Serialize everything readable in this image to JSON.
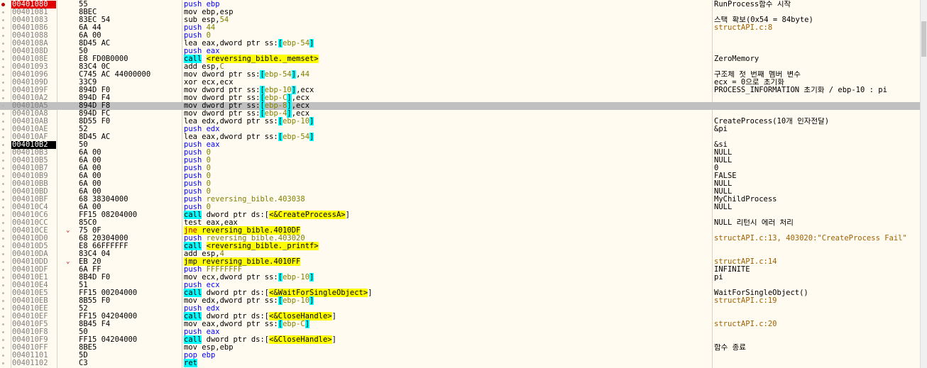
{
  "rows": [
    {
      "addr": "00401080",
      "bytes": "55",
      "asm": [
        {
          "t": "push ",
          "c": "k-push"
        },
        {
          "t": "ebp",
          "c": "k-push"
        }
      ],
      "comment": "RunProcess함수 시작",
      "bp": true,
      "addr_style": "red"
    },
    {
      "addr": "00401081",
      "bytes": "8BEC",
      "asm": [
        {
          "t": "mov ebp,esp"
        }
      ],
      "comment": ""
    },
    {
      "addr": "00401083",
      "bytes": "83EC 54",
      "asm": [
        {
          "t": "sub esp,"
        },
        {
          "t": "54",
          "c": "k-num"
        }
      ],
      "comment": "스택 확보(0x54 = 84byte)"
    },
    {
      "addr": "00401086",
      "bytes": "6A 44",
      "asm": [
        {
          "t": "push ",
          "c": "k-push"
        },
        {
          "t": "44",
          "c": "k-num"
        }
      ],
      "comment": "structAPI.c:8",
      "comment_style": "src"
    },
    {
      "addr": "00401088",
      "bytes": "6A 00",
      "asm": [
        {
          "t": "push ",
          "c": "k-push"
        },
        {
          "t": "0",
          "c": "k-num"
        }
      ],
      "comment": ""
    },
    {
      "addr": "0040108A",
      "bytes": "8D45 AC",
      "asm": [
        {
          "t": "lea eax,dword ptr ss:"
        },
        {
          "t": "[",
          "c": "hl-cy"
        },
        {
          "t": "ebp-54",
          "c": "k-num"
        },
        {
          "t": "]",
          "c": "hl-cy"
        }
      ],
      "comment": ""
    },
    {
      "addr": "0040108D",
      "bytes": "50",
      "asm": [
        {
          "t": "push ",
          "c": "k-push"
        },
        {
          "t": "eax",
          "c": "k-push"
        }
      ],
      "comment": ""
    },
    {
      "addr": "0040108E",
      "bytes": "E8 FD0B0000",
      "asm": [
        {
          "t": "call",
          "c": "hl-cy"
        },
        {
          "t": " "
        },
        {
          "t": "<reversing_bible._memset>",
          "c": "hl-ye"
        }
      ],
      "comment": "ZeroMemory"
    },
    {
      "addr": "00401093",
      "bytes": "83C4 0C",
      "asm": [
        {
          "t": "add esp,"
        },
        {
          "t": "C",
          "c": "k-num"
        }
      ],
      "comment": ""
    },
    {
      "addr": "00401096",
      "bytes": "C745 AC 44000000",
      "asm": [
        {
          "t": "mov dword ptr ss:"
        },
        {
          "t": "[",
          "c": "hl-cy"
        },
        {
          "t": "ebp-54",
          "c": "k-num"
        },
        {
          "t": "]",
          "c": "hl-cy"
        },
        {
          "t": ","
        },
        {
          "t": "44",
          "c": "k-num"
        }
      ],
      "comment": "구조체 첫 번째 멤버 변수"
    },
    {
      "addr": "0040109D",
      "bytes": "33C9",
      "asm": [
        {
          "t": "xor ecx,ecx"
        }
      ],
      "comment": "ecx = 0으로 초기화"
    },
    {
      "addr": "0040109F",
      "bytes": "894D F0",
      "asm": [
        {
          "t": "mov dword ptr ss:"
        },
        {
          "t": "[",
          "c": "hl-cy"
        },
        {
          "t": "ebp-10",
          "c": "k-num"
        },
        {
          "t": "]",
          "c": "hl-cy"
        },
        {
          "t": ",ecx"
        }
      ],
      "comment": "PROCESS_INFORMATION 초기화 / ebp-10 : pi"
    },
    {
      "addr": "004010A2",
      "bytes": "894D F4",
      "asm": [
        {
          "t": "mov dword ptr ss:"
        },
        {
          "t": "[",
          "c": "hl-cy"
        },
        {
          "t": "ebp-C",
          "c": "k-num"
        },
        {
          "t": "]",
          "c": "hl-cy"
        },
        {
          "t": ",ecx"
        }
      ],
      "comment": ""
    },
    {
      "addr": "004010A5",
      "bytes": "894D F8",
      "asm": [
        {
          "t": "mov dword ptr ss:"
        },
        {
          "t": "[",
          "c": "hl-cy"
        },
        {
          "t": "ebp-8",
          "c": "k-num"
        },
        {
          "t": "]",
          "c": "hl-cy"
        },
        {
          "t": ",ecx"
        }
      ],
      "comment": "",
      "selected": true
    },
    {
      "addr": "004010A8",
      "bytes": "894D FC",
      "asm": [
        {
          "t": "mov dword ptr ss:"
        },
        {
          "t": "[",
          "c": "hl-cy"
        },
        {
          "t": "ebp-4",
          "c": "k-num"
        },
        {
          "t": "]",
          "c": "hl-cy"
        },
        {
          "t": ",ecx"
        }
      ],
      "comment": ""
    },
    {
      "addr": "004010AB",
      "bytes": "8D55 F0",
      "asm": [
        {
          "t": "lea edx,dword ptr ss:"
        },
        {
          "t": "[",
          "c": "hl-cy"
        },
        {
          "t": "ebp-10",
          "c": "k-num"
        },
        {
          "t": "]",
          "c": "hl-cy"
        }
      ],
      "comment": "CreateProcess(10개 인자전달)"
    },
    {
      "addr": "004010AE",
      "bytes": "52",
      "asm": [
        {
          "t": "push ",
          "c": "k-push"
        },
        {
          "t": "edx",
          "c": "k-push"
        }
      ],
      "comment": "&pi"
    },
    {
      "addr": "004010AF",
      "bytes": "8D45 AC",
      "asm": [
        {
          "t": "lea eax,dword ptr ss:"
        },
        {
          "t": "[",
          "c": "hl-cy"
        },
        {
          "t": "ebp-54",
          "c": "k-num"
        },
        {
          "t": "]",
          "c": "hl-cy"
        }
      ],
      "comment": ""
    },
    {
      "addr": "004010B2",
      "bytes": "50",
      "asm": [
        {
          "t": "push ",
          "c": "k-push"
        },
        {
          "t": "eax",
          "c": "k-push"
        }
      ],
      "comment": "&si",
      "addr_style": "blk"
    },
    {
      "addr": "004010B3",
      "bytes": "6A 00",
      "asm": [
        {
          "t": "push ",
          "c": "k-push"
        },
        {
          "t": "0",
          "c": "k-num"
        }
      ],
      "comment": "NULL"
    },
    {
      "addr": "004010B5",
      "bytes": "6A 00",
      "asm": [
        {
          "t": "push ",
          "c": "k-push"
        },
        {
          "t": "0",
          "c": "k-num"
        }
      ],
      "comment": "NULL"
    },
    {
      "addr": "004010B7",
      "bytes": "6A 00",
      "asm": [
        {
          "t": "push ",
          "c": "k-push"
        },
        {
          "t": "0",
          "c": "k-num"
        }
      ],
      "comment": "0"
    },
    {
      "addr": "004010B9",
      "bytes": "6A 00",
      "asm": [
        {
          "t": "push ",
          "c": "k-push"
        },
        {
          "t": "0",
          "c": "k-num"
        }
      ],
      "comment": "FALSE"
    },
    {
      "addr": "004010BB",
      "bytes": "6A 00",
      "asm": [
        {
          "t": "push ",
          "c": "k-push"
        },
        {
          "t": "0",
          "c": "k-num"
        }
      ],
      "comment": "NULL"
    },
    {
      "addr": "004010BD",
      "bytes": "6A 00",
      "asm": [
        {
          "t": "push ",
          "c": "k-push"
        },
        {
          "t": "0",
          "c": "k-num"
        }
      ],
      "comment": "NULL"
    },
    {
      "addr": "004010BF",
      "bytes": "68 38304000",
      "asm": [
        {
          "t": "push ",
          "c": "k-push"
        },
        {
          "t": "reversing_bible.403038",
          "c": "k-lab"
        }
      ],
      "comment": "MyChildProcess"
    },
    {
      "addr": "004010C4",
      "bytes": "6A 00",
      "asm": [
        {
          "t": "push ",
          "c": "k-push"
        },
        {
          "t": "0",
          "c": "k-num"
        }
      ],
      "comment": "NULL"
    },
    {
      "addr": "004010C6",
      "bytes": "FF15 08204000",
      "asm": [
        {
          "t": "call",
          "c": "hl-cy"
        },
        {
          "t": " dword ptr ds:["
        },
        {
          "t": "<&CreateProcessA>",
          "c": "hl-ye"
        },
        {
          "t": "]"
        }
      ],
      "comment": ""
    },
    {
      "addr": "004010CC",
      "bytes": "85C0",
      "asm": [
        {
          "t": "test eax,eax"
        }
      ],
      "comment": "NULL 리턴시 에러 처리"
    },
    {
      "addr": "004010CE",
      "bytes": "75 0F",
      "asm": [
        {
          "t": "jne ",
          "c": "k-jcc hl-ye"
        },
        {
          "t": "reversing_bible.4010DF",
          "c": "hl-ye"
        }
      ],
      "comment": "",
      "jump": "⌄"
    },
    {
      "addr": "004010D0",
      "bytes": "68 20304000",
      "asm": [
        {
          "t": "push ",
          "c": "k-push"
        },
        {
          "t": "reversing_bible.403020",
          "c": "k-lab"
        }
      ],
      "comment": "structAPI.c:13, 403020:\"CreateProcess Fail\"",
      "comment_style": "src"
    },
    {
      "addr": "004010D5",
      "bytes": "E8 66FFFFFF",
      "asm": [
        {
          "t": "call",
          "c": "hl-cy"
        },
        {
          "t": " "
        },
        {
          "t": "<reversing_bible._printf>",
          "c": "hl-ye"
        }
      ],
      "comment": ""
    },
    {
      "addr": "004010DA",
      "bytes": "83C4 04",
      "asm": [
        {
          "t": "add esp,"
        },
        {
          "t": "4",
          "c": "k-num"
        }
      ],
      "comment": ""
    },
    {
      "addr": "004010DD",
      "bytes": "EB 20",
      "asm": [
        {
          "t": "jmp ",
          "c": "k-jmp hl-ye"
        },
        {
          "t": "reversing_bible.4010FF",
          "c": "hl-ye"
        }
      ],
      "comment": "structAPI.c:14",
      "comment_style": "src",
      "jump": "⌄"
    },
    {
      "addr": "004010DF",
      "bytes": "6A FF",
      "asm": [
        {
          "t": "push ",
          "c": "k-push"
        },
        {
          "t": "FFFFFFFF",
          "c": "k-num"
        }
      ],
      "comment": "INFINITE"
    },
    {
      "addr": "004010E1",
      "bytes": "8B4D F0",
      "asm": [
        {
          "t": "mov ecx,dword ptr ss:"
        },
        {
          "t": "[",
          "c": "hl-cy"
        },
        {
          "t": "ebp-10",
          "c": "k-num"
        },
        {
          "t": "]",
          "c": "hl-cy"
        }
      ],
      "comment": "pi"
    },
    {
      "addr": "004010E4",
      "bytes": "51",
      "asm": [
        {
          "t": "push ",
          "c": "k-push"
        },
        {
          "t": "ecx",
          "c": "k-push"
        }
      ],
      "comment": ""
    },
    {
      "addr": "004010E5",
      "bytes": "FF15 00204000",
      "asm": [
        {
          "t": "call",
          "c": "hl-cy"
        },
        {
          "t": " dword ptr ds:["
        },
        {
          "t": "<&WaitForSingleObject>",
          "c": "hl-ye"
        },
        {
          "t": "]"
        }
      ],
      "comment": "WaitForSingleObject()"
    },
    {
      "addr": "004010EB",
      "bytes": "8B55 F0",
      "asm": [
        {
          "t": "mov edx,dword ptr ss:"
        },
        {
          "t": "[",
          "c": "hl-cy"
        },
        {
          "t": "ebp-10",
          "c": "k-num"
        },
        {
          "t": "]",
          "c": "hl-cy"
        }
      ],
      "comment": "structAPI.c:19",
      "comment_style": "src"
    },
    {
      "addr": "004010EE",
      "bytes": "52",
      "asm": [
        {
          "t": "push ",
          "c": "k-push"
        },
        {
          "t": "edx",
          "c": "k-push"
        }
      ],
      "comment": ""
    },
    {
      "addr": "004010EF",
      "bytes": "FF15 04204000",
      "asm": [
        {
          "t": "call",
          "c": "hl-cy"
        },
        {
          "t": " dword ptr ds:["
        },
        {
          "t": "<&CloseHandle>",
          "c": "hl-ye"
        },
        {
          "t": "]"
        }
      ],
      "comment": ""
    },
    {
      "addr": "004010F5",
      "bytes": "8B45 F4",
      "asm": [
        {
          "t": "mov eax,dword ptr ss:"
        },
        {
          "t": "[",
          "c": "hl-cy"
        },
        {
          "t": "ebp-C",
          "c": "k-num"
        },
        {
          "t": "]",
          "c": "hl-cy"
        }
      ],
      "comment": "structAPI.c:20",
      "comment_style": "src"
    },
    {
      "addr": "004010F8",
      "bytes": "50",
      "asm": [
        {
          "t": "push ",
          "c": "k-push"
        },
        {
          "t": "eax",
          "c": "k-push"
        }
      ],
      "comment": ""
    },
    {
      "addr": "004010F9",
      "bytes": "FF15 04204000",
      "asm": [
        {
          "t": "call",
          "c": "hl-cy"
        },
        {
          "t": " dword ptr ds:["
        },
        {
          "t": "<&CloseHandle>",
          "c": "hl-ye"
        },
        {
          "t": "]"
        }
      ],
      "comment": ""
    },
    {
      "addr": "004010FF",
      "bytes": "8BE5",
      "asm": [
        {
          "t": "mov esp,ebp"
        }
      ],
      "comment": "함수 종료"
    },
    {
      "addr": "00401101",
      "bytes": "5D",
      "asm": [
        {
          "t": "pop ",
          "c": "k-push"
        },
        {
          "t": "ebp",
          "c": "k-push"
        }
      ],
      "comment": ""
    },
    {
      "addr": "00401102",
      "bytes": "C3",
      "asm": [
        {
          "t": "ret",
          "c": "hl-cy"
        }
      ],
      "comment": ""
    }
  ],
  "colors": {
    "background": "#fffbf0",
    "breakpoint_address": "#e00000",
    "current_address": "#000000",
    "selected_row": "#c0c0c0",
    "call_ret_highlight": "#00ffff",
    "jump_target_highlight": "#ffff00",
    "source_comment": "#a06000"
  }
}
